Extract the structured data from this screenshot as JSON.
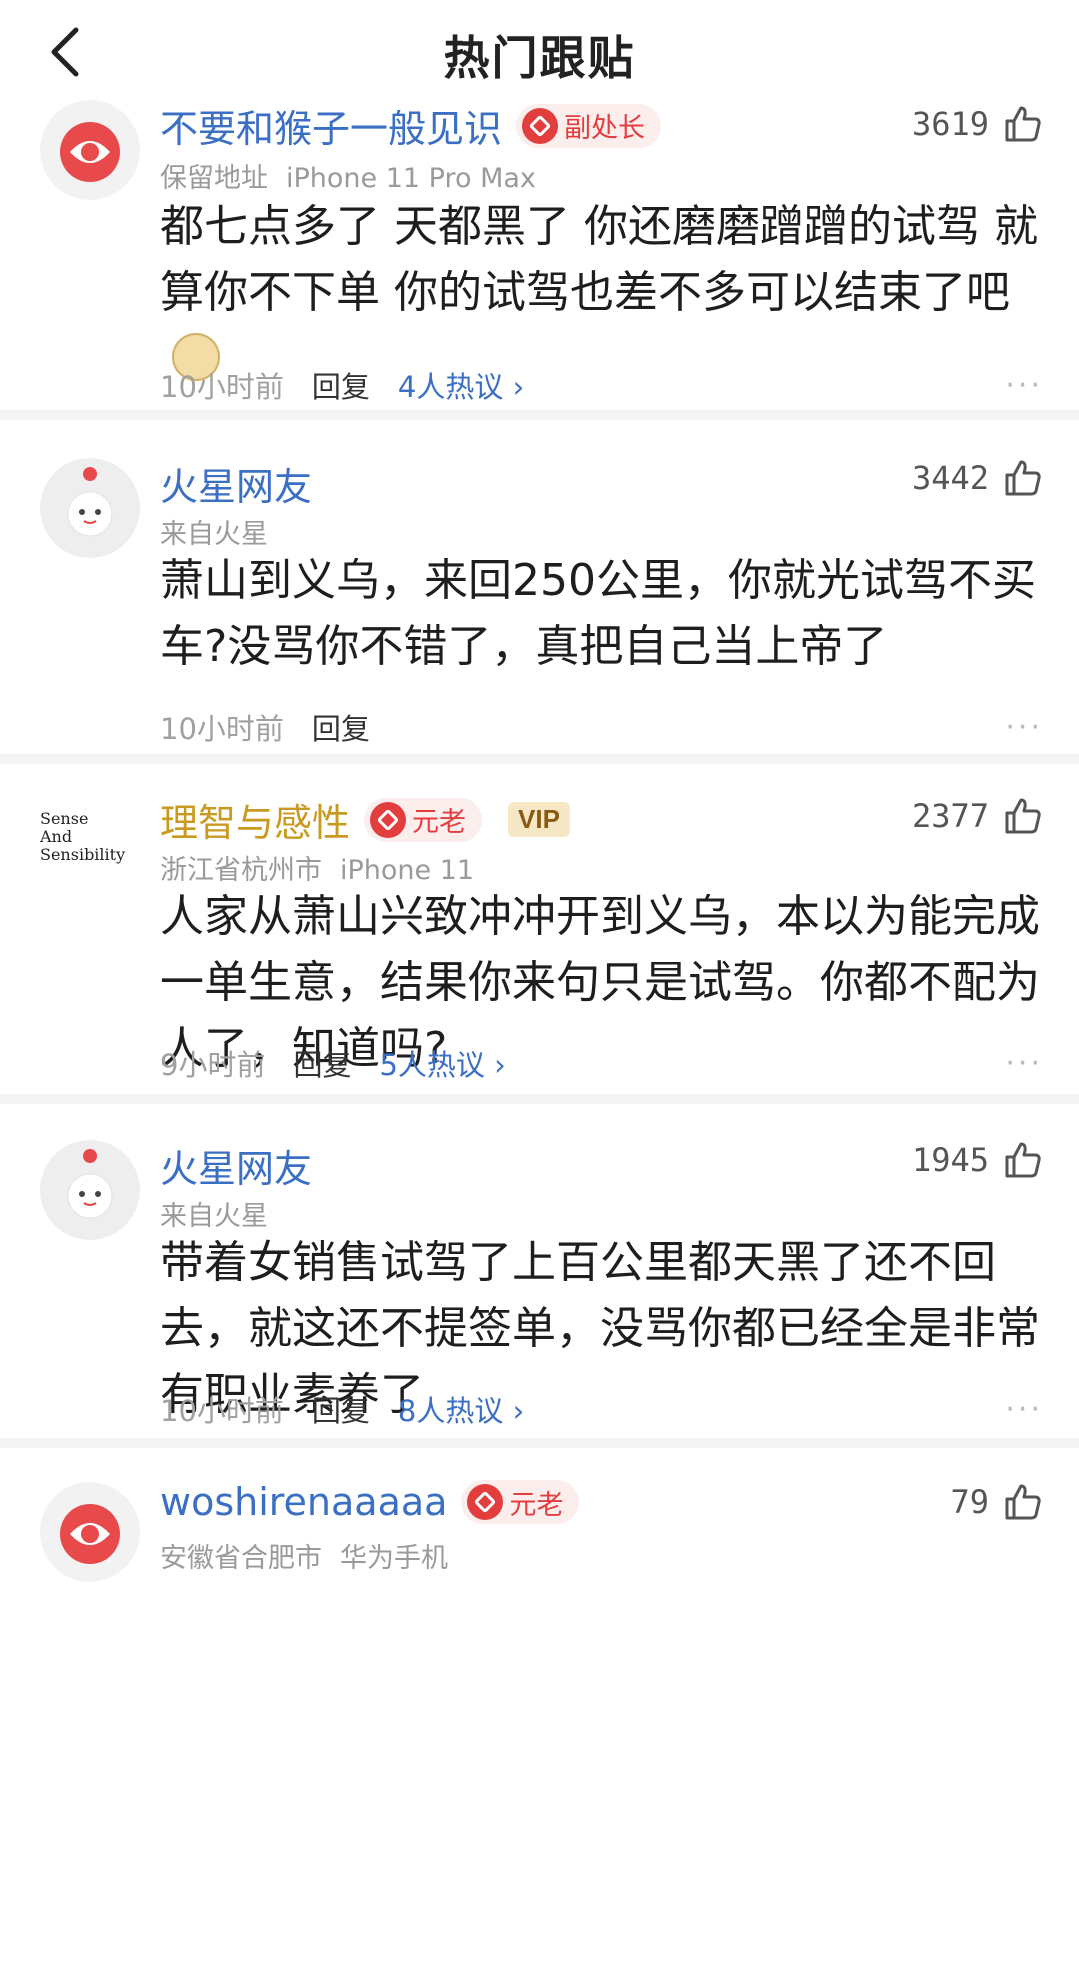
{
  "header": {
    "title": "热门跟贴"
  },
  "comments": [
    {
      "username": "不要和猴子一般见识",
      "badge": "副处长",
      "meta": [
        "保留地址",
        "iPhone 11 Pro Max"
      ],
      "likes": "3619",
      "text": "都七点多了 天都黑了 你还磨磨蹭蹭的试驾 就算你不下单 你的试驾也差不多可以结束了吧",
      "time": "10小时前",
      "reply": "回复",
      "hot": "4人热议",
      "more": "···"
    },
    {
      "username": "火星网友",
      "meta": [
        "来自火星"
      ],
      "likes": "3442",
      "text": "萧山到义乌，来回250公里，你就光试驾不买车?没骂你不错了，真把自己当上帝了",
      "time": "10小时前",
      "reply": "回复",
      "more": "···"
    },
    {
      "username": "理智与感性",
      "badge": "元老",
      "vip": "VIP",
      "avatar_text": [
        "Sense",
        "And",
        "Sensibility"
      ],
      "meta": [
        "浙江省杭州市",
        "iPhone 11"
      ],
      "likes": "2377",
      "text": "人家从萧山兴致冲冲开到义乌，本以为能完成一单生意，结果你来句只是试驾。你都不配为人了，知道吗?",
      "time": "9小时前",
      "reply": "回复",
      "hot": "5人热议",
      "more": "···"
    },
    {
      "username": "火星网友",
      "meta": [
        "来自火星"
      ],
      "likes": "1945",
      "text": "带着女销售试驾了上百公里都天黑了还不回去，就这还不提签单，没骂你都已经全是非常有职业素养了",
      "time": "10小时前",
      "reply": "回复",
      "hot": "8人热议",
      "more": "···"
    },
    {
      "username": "woshirenaaaaa",
      "badge": "元老",
      "meta": [
        "安徽省合肥市",
        "华为手机"
      ],
      "likes": "79"
    }
  ],
  "colors": {
    "link": "#3b6fc4",
    "gold_name": "#c99a1f",
    "badge_red": "#e23e3e"
  }
}
